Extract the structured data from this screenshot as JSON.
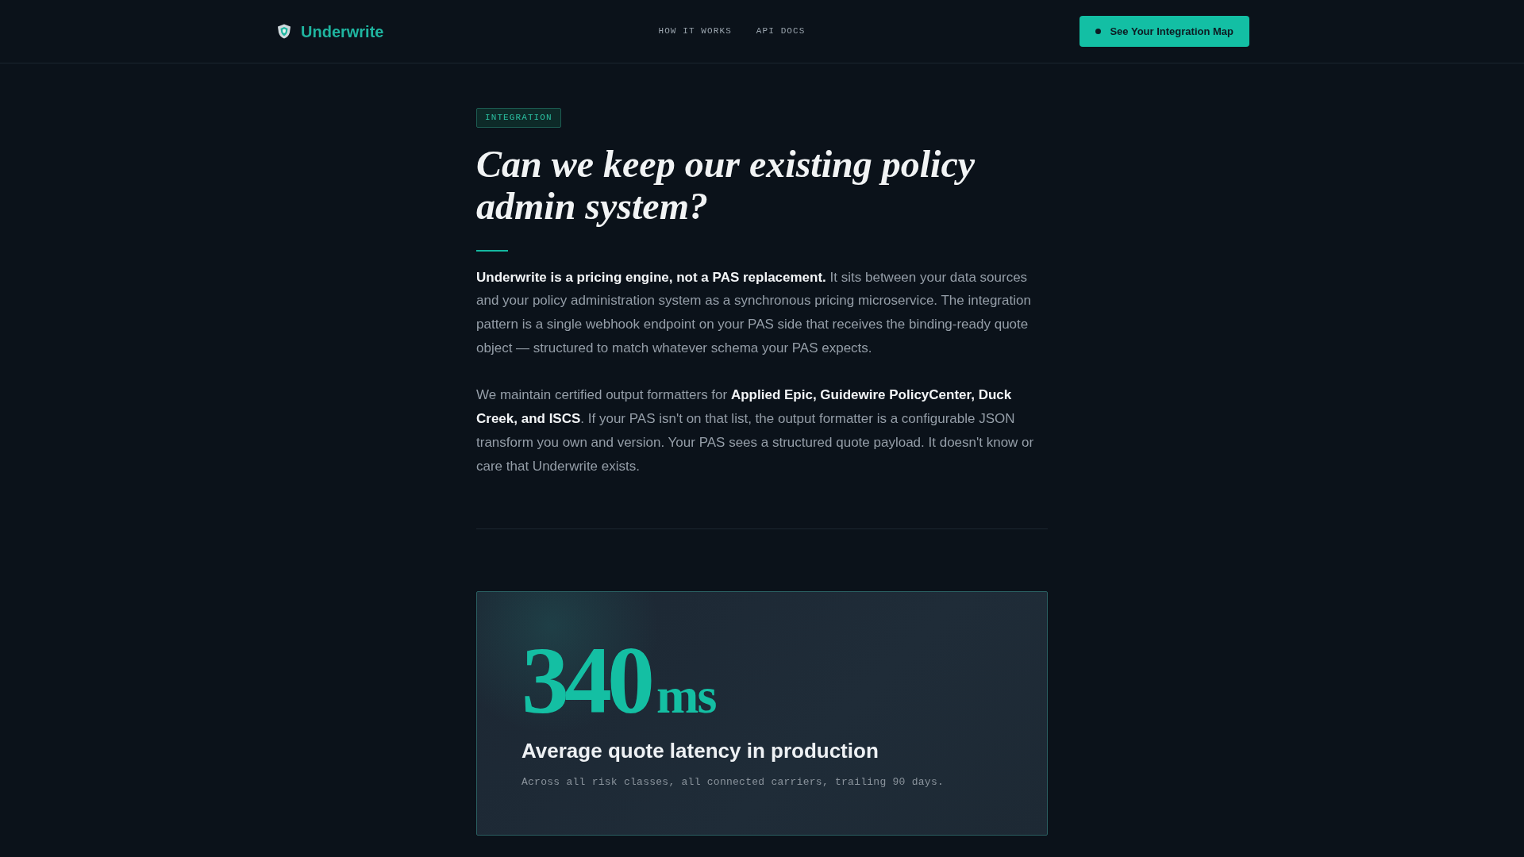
{
  "header": {
    "logo": {
      "text": "Underwrite"
    },
    "nav": [
      {
        "label": "HOW IT WORKS"
      },
      {
        "label": "API DOCS"
      }
    ],
    "cta": {
      "label": "See Your Integration Map"
    }
  },
  "article": {
    "badge": "INTEGRATION",
    "title": "Can we keep our existing policy admin system?",
    "paragraphs": [
      "**Underwrite is a pricing engine, not a PAS replacement.** It sits between your data sources and your policy administration system as a synchronous pricing microservice. The integration pattern is a single webhook endpoint on your PAS side that receives the binding-ready quote object — structured to match whatever schema your PAS expects.",
      "We maintain certified output formatters for **Applied Epic, Guidewire PolicyCenter, Duck Creek, and ISCS**. If your PAS isn't on that list, the output formatter is a configurable JSON transform you own and version. Your PAS sees a structured quote payload. It doesn't know or care that Underwrite exists."
    ]
  },
  "stat_card": {
    "value": "340",
    "unit": "ms",
    "label": "Average quote latency in production",
    "note": "Across all risk classes, all connected carriers, trailing 90 days."
  }
}
